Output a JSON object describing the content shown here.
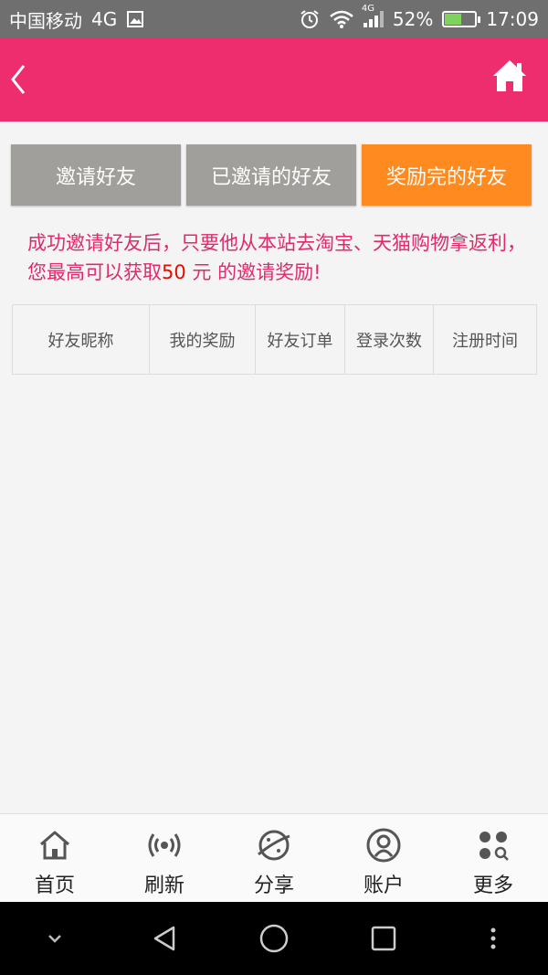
{
  "status_bar": {
    "carrier": "中国移动",
    "network": "4G",
    "signal_badge": "4G",
    "battery_percent": "52%",
    "time": "17:09",
    "icons": [
      "image-icon",
      "alarm-icon",
      "wifi-icon",
      "signal-icon",
      "battery-icon"
    ]
  },
  "header": {
    "back_icon": "back-chevron-icon",
    "home_icon": "home-icon",
    "background": "#ee2d6f"
  },
  "tabs": [
    {
      "label": "邀请好友",
      "active": false
    },
    {
      "label": "已邀请的好友",
      "active": false
    },
    {
      "label": "奖励完的好友",
      "active": true
    }
  ],
  "notice": {
    "text_before": "成功邀请好友后，只要他从本站去淘宝、天猫购物拿返利，您最高可以获取",
    "amount": "50",
    "text_after": " 元 的邀请奖励!"
  },
  "table": {
    "columns": [
      "好友昵称",
      "我的奖励",
      "好友订单",
      "登录次数",
      "注册时间"
    ],
    "rows": []
  },
  "bottom_nav": [
    {
      "label": "首页",
      "icon": "home-icon"
    },
    {
      "label": "刷新",
      "icon": "broadcast-icon"
    },
    {
      "label": "分享",
      "icon": "planet-icon"
    },
    {
      "label": "账户",
      "icon": "account-icon"
    },
    {
      "label": "更多",
      "icon": "more-grid-icon"
    }
  ],
  "system_nav": [
    "collapse-icon",
    "back-triangle-icon",
    "home-circle-icon",
    "recents-square-icon",
    "overflow-dots-icon"
  ],
  "colors": {
    "accent": "#ee2d6f",
    "active_tab": "#ff8a1f",
    "inactive_tab": "#a09f9b",
    "notice_text": "#e02a6b",
    "amount_text": "#e60d00"
  }
}
